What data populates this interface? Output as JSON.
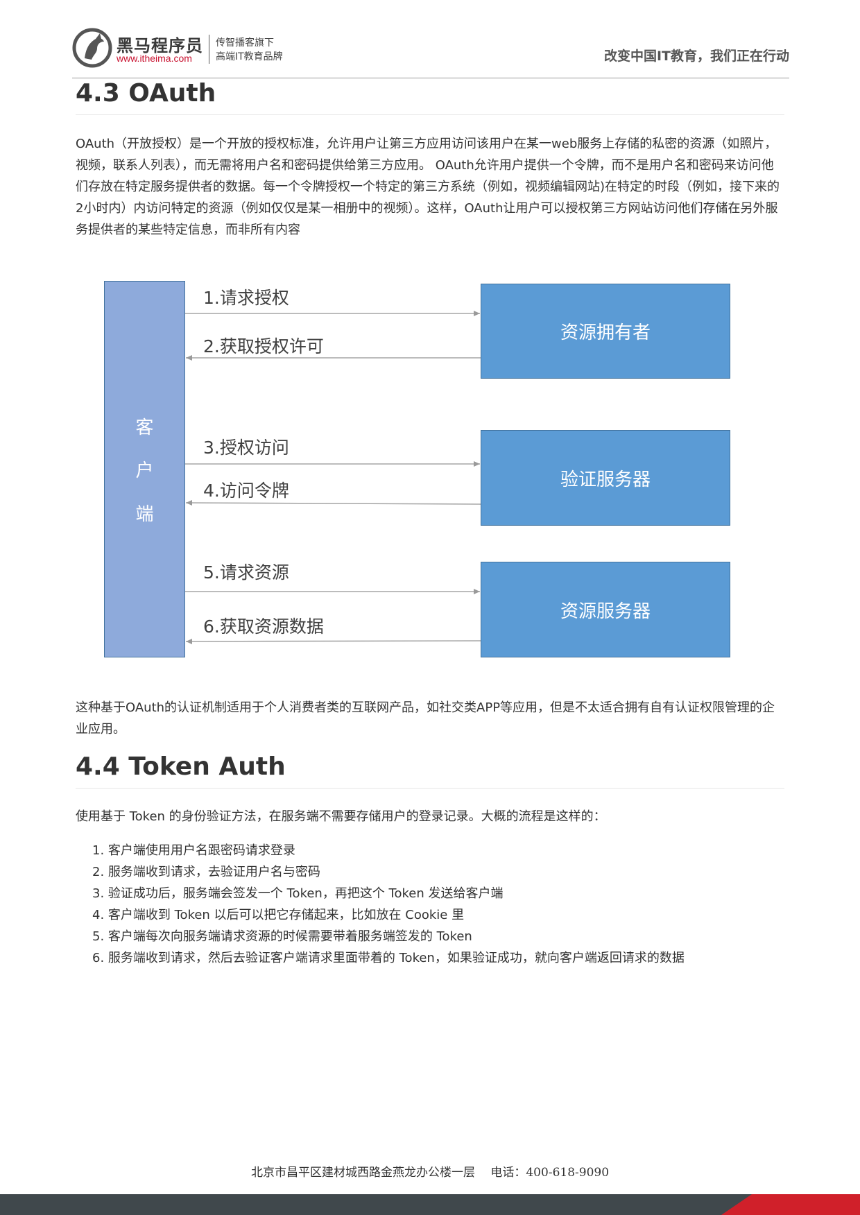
{
  "header": {
    "brand_name": "黑马程序员",
    "brand_url": "www.itheima.com",
    "slogan_line1": "传智播客旗下",
    "slogan_line2": "高端IT教育品牌",
    "tagline": "改变中国IT教育，我们正在行动"
  },
  "section_oauth": {
    "heading": "4.3 OAuth",
    "intro": "OAuth（开放授权）是一个开放的授权标准，允许用户让第三方应用访问该用户在某一web服务上存储的私密的资源（如照片，视频，联系人列表），而无需将用户名和密码提供给第三方应用。 OAuth允许用户提供一个令牌，而不是用户名和密码来访问他们存放在特定服务提供者的数据。每一个令牌授权一个特定的第三方系统（例如，视频编辑网站)在特定的时段（例如，接下来的2小时内）内访问特定的资源（例如仅仅是某一相册中的视频）。这样，OAuth让用户可以授权第三方网站访问他们存储在另外服务提供者的某些特定信息，而非所有内容",
    "diagram": {
      "client_chars": [
        "客",
        "户",
        "端"
      ],
      "owner_box": "资源拥有者",
      "auth_box": "验证服务器",
      "resource_box": "资源服务器",
      "steps": [
        "1.请求授权",
        "2.获取授权许可",
        "3.授权访问",
        "4.访问令牌",
        "5.请求资源",
        "6.获取资源数据"
      ]
    },
    "after": "这种基于OAuth的认证机制适用于个人消费者类的互联网产品，如社交类APP等应用，但是不太适合拥有自有认证权限管理的企业应用。"
  },
  "section_token": {
    "heading": "4.4 Token Auth",
    "intro": "使用基于 Token 的身份验证方法，在服务端不需要存储用户的登录记录。大概的流程是这样的：",
    "steps": [
      "1. 客户端使用用户名跟密码请求登录",
      "2. 服务端收到请求，去验证用户名与密码",
      "3. 验证成功后，服务端会签发一个 Token，再把这个 Token 发送给客户端",
      "4. 客户端收到 Token 以后可以把它存储起来，比如放在 Cookie 里",
      "5. 客户端每次向服务端请求资源的时候需要带着服务端签发的 Token",
      "6. 服务端收到请求，然后去验证客户端请求里面带着的 Token，如果验证成功，就向客户端返回请求的数据"
    ]
  },
  "footer": {
    "address": "北京市昌平区建材城西路金燕龙办公楼一层　 电话：400-618-9090"
  }
}
